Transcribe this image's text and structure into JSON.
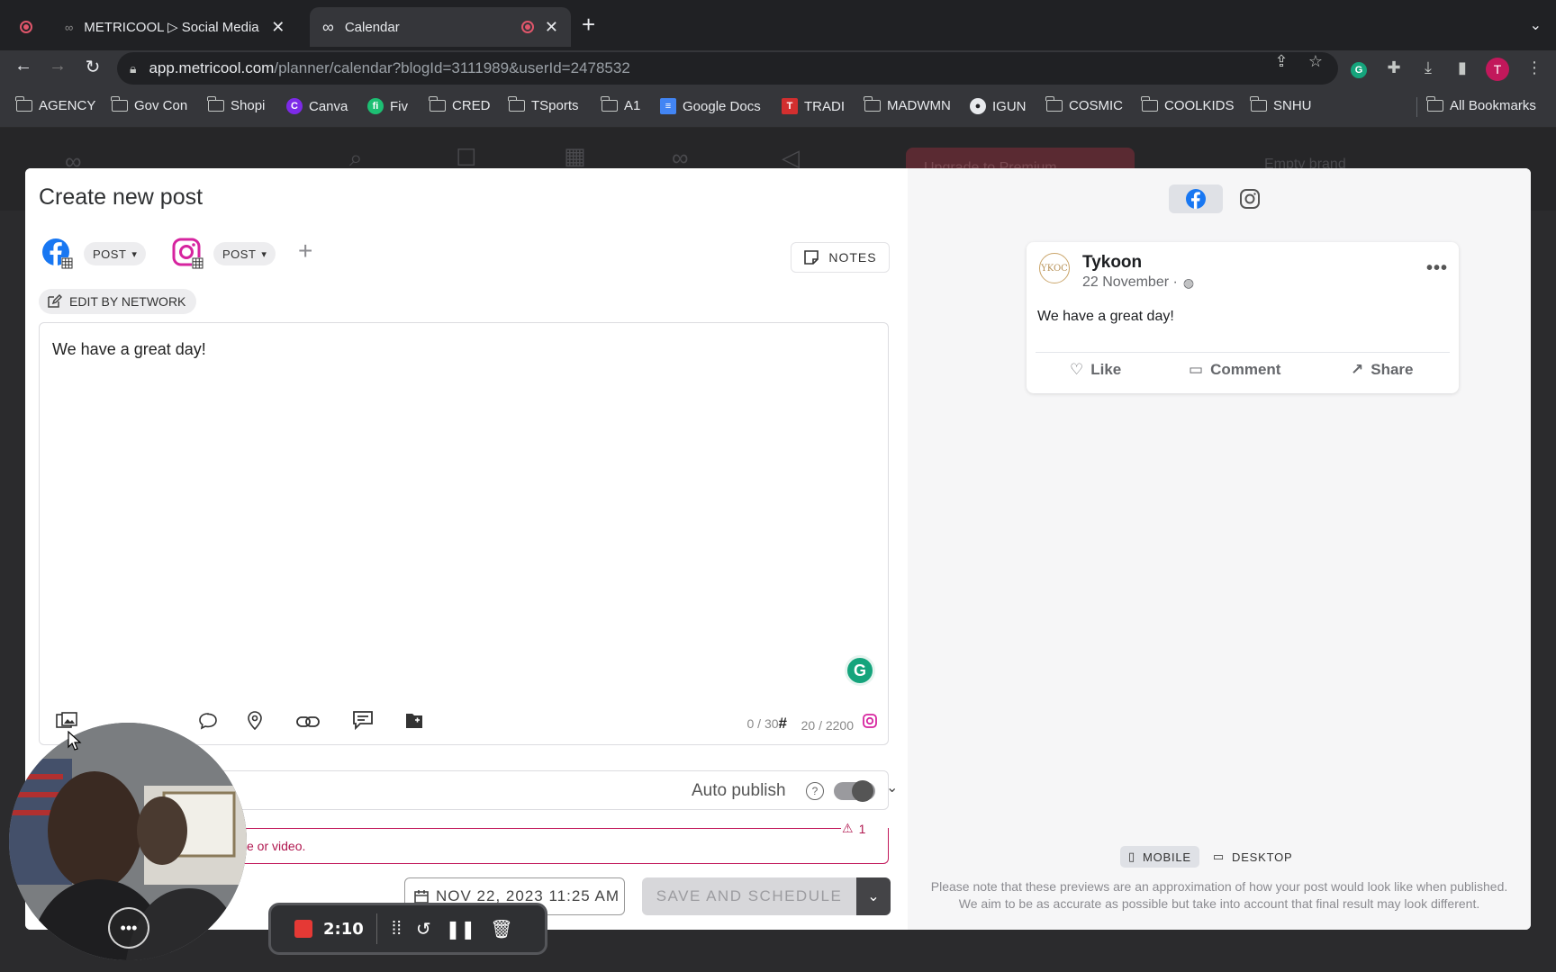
{
  "browser": {
    "tabs": [
      {
        "title": "METRICOOL ▷ Social Media M",
        "active": false
      },
      {
        "title": "Calendar",
        "active": true
      }
    ],
    "url_domain": "app.metricool.com",
    "url_path": "/planner/calendar?blogId=3111989&userId=2478532",
    "profile_initial": "T",
    "bookmarks": [
      "AGENCY",
      "Gov Con",
      "Shopi",
      "Canva",
      "Fiv",
      "CRED",
      "TSports",
      "A1",
      "Google Docs",
      "TRADI",
      "MADWMN",
      "IGUN",
      "COSMIC",
      "COOLKIDS",
      "SNHU"
    ],
    "all_bookmarks": "All Bookmarks"
  },
  "background": {
    "upgrade_label": "Upgrade to Premium",
    "brand_label": "Empty brand"
  },
  "composer": {
    "title": "Create new post",
    "networks": [
      {
        "name": "facebook",
        "type": "POST"
      },
      {
        "name": "instagram",
        "type": "POST"
      }
    ],
    "notes_label": "NOTES",
    "edit_by_network_label": "EDIT BY NETWORK",
    "text": "We have a great day!",
    "hashtag_count": "0 / 30",
    "char_count": "20 / 2200",
    "auto_publish_label": "Auto publish",
    "auto_publish_on": true,
    "error_text": "e or video.",
    "error_count": "1",
    "date_label": "NOV 22, 2023 11:25 AM",
    "save_label": "SAVE AND SCHEDULE"
  },
  "preview": {
    "active_network": "facebook",
    "account_name": "Tykoon",
    "avatar_text": "YKOC",
    "date": "22 November ·",
    "post_text": "We have a great day!",
    "actions": {
      "like": "Like",
      "comment": "Comment",
      "share": "Share"
    },
    "device_mobile": "MOBILE",
    "device_desktop": "DESKTOP",
    "note_line1": "Please note that these previews are an approximation of how your post would look like when published.",
    "note_line2": "We aim to be as accurate as possible but take into account that final result may look different."
  },
  "recorder": {
    "time": "2:10"
  },
  "colors": {
    "facebook": "#1877f2",
    "instagram": "#d6249f",
    "grammarly": "#15a47c",
    "error": "#c2185b"
  }
}
